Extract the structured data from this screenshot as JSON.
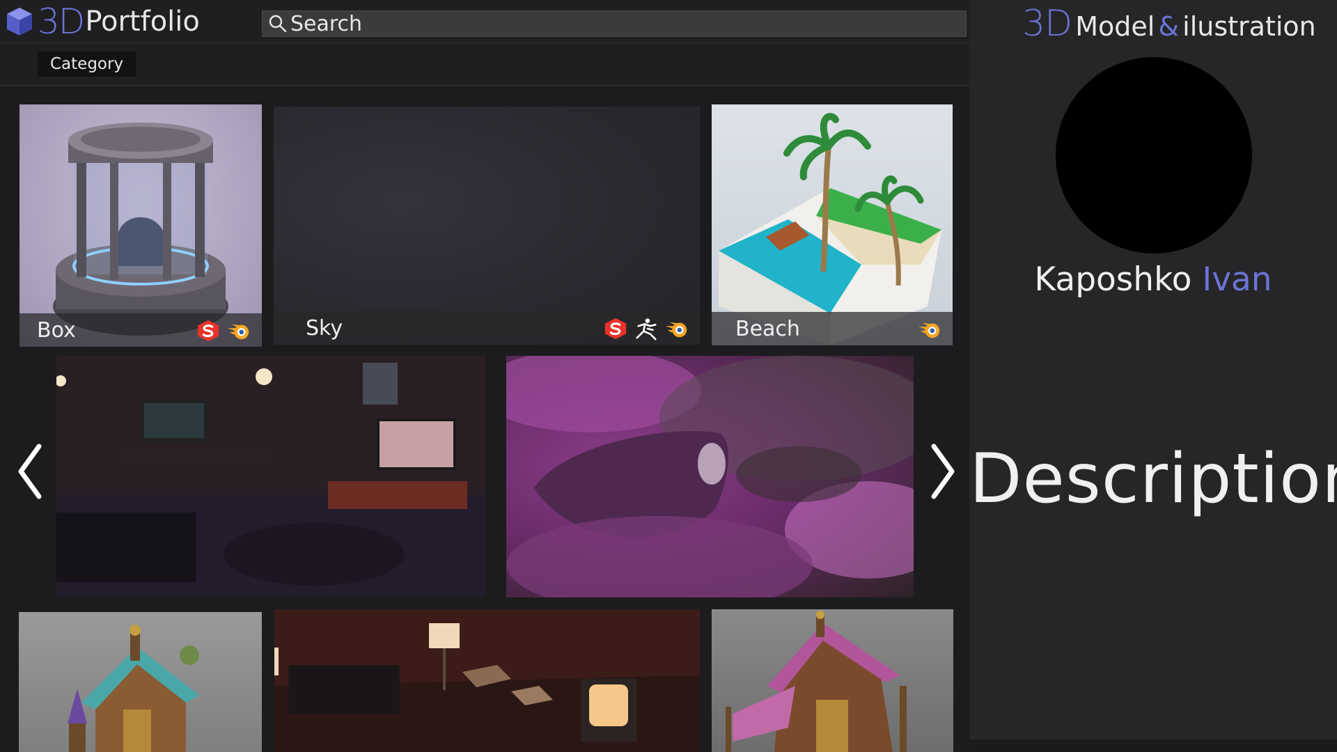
{
  "header": {
    "logo_3d": "3D",
    "logo_word": "Portfolio",
    "search_placeholder": "Search"
  },
  "category": {
    "label": "Category"
  },
  "gallery": {
    "row1": [
      {
        "name": "Box",
        "tools": [
          "substance-painter-icon",
          "blender-icon"
        ]
      },
      {
        "name": "Sky",
        "tools": [
          "substance-painter-icon",
          "zbrush-icon",
          "blender-icon"
        ]
      },
      {
        "name": "Beach",
        "tools": [
          "blender-icon"
        ]
      }
    ],
    "carousel": {
      "slides": [
        "room-scene",
        "airship-in-clouds"
      ]
    },
    "row3": [
      "fantasy-house",
      "dark-room",
      "fantasy-shop"
    ]
  },
  "profile": {
    "title_3d": "3D",
    "title_word1": "Model",
    "title_amp": "&",
    "title_word2": "ilustration",
    "first_name": "Kaposhko",
    "last_name": "Ivan",
    "description": "Description"
  },
  "colors": {
    "accent": "#6c74d6",
    "background": "#1c1c1e",
    "panel": "#262628",
    "substance": "#e8332a",
    "blender": "#f5a623"
  }
}
